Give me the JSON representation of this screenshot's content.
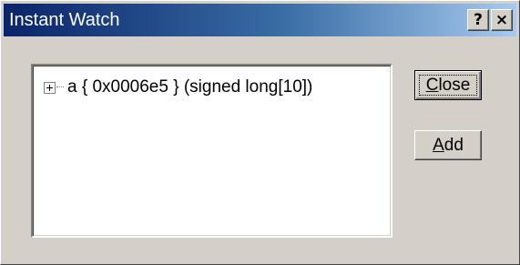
{
  "window": {
    "title": "Instant Watch",
    "help_label": "?",
    "close_label": "×"
  },
  "watch": {
    "expander_icon": "plus-box-icon",
    "row_text": "a  { 0x0006e5 } (signed long[10])"
  },
  "buttons": {
    "close": {
      "mnemonic": "C",
      "rest": "lose"
    },
    "add": {
      "mnemonic": "A",
      "rest": "dd"
    }
  },
  "colors": {
    "title_gradient_start": "#0a246a",
    "title_gradient_end": "#a6caf0",
    "face": "#d4d0c8"
  }
}
